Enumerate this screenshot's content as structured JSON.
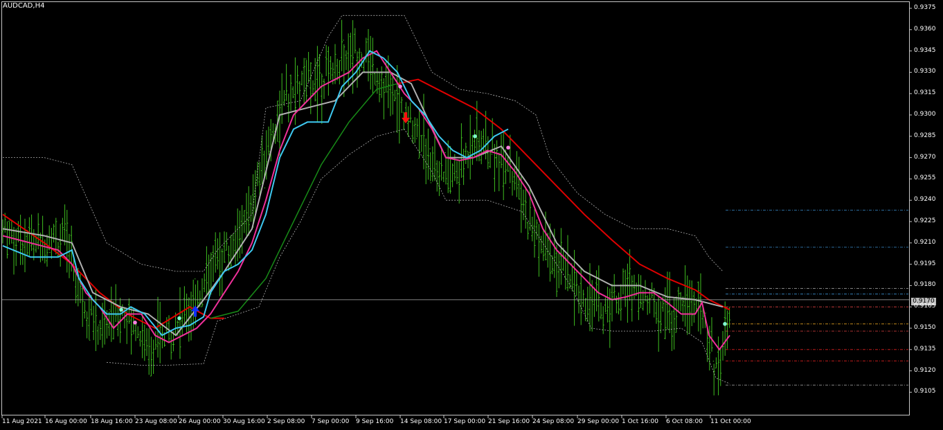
{
  "window": {
    "title": "AUDCAD,H4"
  },
  "price_tag": "0.9170",
  "colors": {
    "background": "#000000",
    "bars": "#3fbf1f",
    "ma_slow": "#e00000",
    "ma_green": "#178a17",
    "line_cyan": "#3ec8f0",
    "line_pink": "#f0309a",
    "line_gray": "#b0b0b0",
    "envelope": "#b0b0b0",
    "up_arrow": "#1030ff",
    "down_arrow": "#ff1010"
  },
  "chart_data": {
    "type": "line",
    "title": "AUDCAD,H4",
    "ylim": [
      0.9095,
      0.9381
    ],
    "y_ticks": [
      "0.9375",
      "0.9360",
      "0.9345",
      "0.9330",
      "0.9315",
      "0.9300",
      "0.9285",
      "0.9270",
      "0.9255",
      "0.9240",
      "0.9225",
      "0.9210",
      "0.9195",
      "0.9180",
      "0.9165",
      "0.9150",
      "0.9135",
      "0.9120",
      "0.9105"
    ],
    "x_ticks": [
      "11 Aug 2021",
      "16 Aug 00:00",
      "18 Aug 16:00",
      "23 Aug 08:00",
      "26 Aug 00:00",
      "30 Aug 16:00",
      "2 Sep 08:00",
      "7 Sep 00:00",
      "9 Sep 16:00",
      "14 Sep 08:00",
      "17 Sep 00:00",
      "21 Sep 16:00",
      "24 Sep 08:00",
      "29 Sep 00:00",
      "1 Oct 16:00",
      "6 Oct 08:00",
      "11 Oct 00:00"
    ],
    "current_price": 0.917,
    "price_series": [
      [
        0,
        0.9218
      ],
      [
        40,
        0.921
      ],
      [
        70,
        0.9214
      ],
      [
        90,
        0.9212
      ],
      [
        100,
        0.92
      ],
      [
        110,
        0.918
      ],
      [
        120,
        0.9165
      ],
      [
        140,
        0.915
      ],
      [
        160,
        0.9158
      ],
      [
        175,
        0.9162
      ],
      [
        195,
        0.915
      ],
      [
        210,
        0.9135
      ],
      [
        230,
        0.914
      ],
      [
        250,
        0.915
      ],
      [
        270,
        0.9165
      ],
      [
        290,
        0.918
      ],
      [
        310,
        0.92
      ],
      [
        330,
        0.9205
      ],
      [
        350,
        0.9225
      ],
      [
        370,
        0.9255
      ],
      [
        390,
        0.929
      ],
      [
        410,
        0.931
      ],
      [
        430,
        0.932
      ],
      [
        450,
        0.9325
      ],
      [
        470,
        0.933
      ],
      [
        490,
        0.934
      ],
      [
        510,
        0.9345
      ],
      [
        530,
        0.9338
      ],
      [
        550,
        0.932
      ],
      [
        570,
        0.931
      ],
      [
        580,
        0.93
      ],
      [
        600,
        0.929
      ],
      [
        620,
        0.927
      ],
      [
        640,
        0.9255
      ],
      [
        660,
        0.926
      ],
      [
        680,
        0.9285
      ],
      [
        700,
        0.9275
      ],
      [
        720,
        0.927
      ],
      [
        740,
        0.926
      ],
      [
        750,
        0.9235
      ],
      [
        770,
        0.9215
      ],
      [
        790,
        0.92
      ],
      [
        810,
        0.919
      ],
      [
        830,
        0.9175
      ],
      [
        850,
        0.917
      ],
      [
        870,
        0.9162
      ],
      [
        890,
        0.9175
      ],
      [
        910,
        0.918
      ],
      [
        930,
        0.917
      ],
      [
        950,
        0.9165
      ],
      [
        970,
        0.916
      ],
      [
        990,
        0.917
      ],
      [
        1010,
        0.9165
      ],
      [
        1020,
        0.914
      ],
      [
        1030,
        0.912
      ],
      [
        1040,
        0.914
      ],
      [
        1050,
        0.917
      ]
    ],
    "series": [
      {
        "name": "",
        "points": [
          [
            0,
            0.923
          ],
          [
            60,
            0.921
          ],
          [
            100,
            0.9195
          ],
          [
            140,
            0.9175
          ],
          [
            180,
            0.916
          ],
          [
            220,
            0.915
          ],
          [
            270,
            0.9165
          ],
          [
            300,
            0.9157
          ],
          [
            320,
            0.9157
          ]
        ]
      },
      {
        "name": "",
        "points": [
          [
            300,
            0.9157
          ],
          [
            340,
            0.9162
          ],
          [
            380,
            0.9185
          ],
          [
            420,
            0.9225
          ],
          [
            460,
            0.9265
          ],
          [
            500,
            0.9295
          ],
          [
            540,
            0.9318
          ],
          [
            570,
            0.9322
          ]
        ]
      },
      {
        "name": "",
        "points": [
          [
            570,
            0.9322
          ],
          [
            600,
            0.9325
          ],
          [
            640,
            0.9315
          ],
          [
            680,
            0.9305
          ],
          [
            720,
            0.929
          ],
          [
            760,
            0.927
          ],
          [
            800,
            0.925
          ],
          [
            840,
            0.923
          ],
          [
            880,
            0.9212
          ],
          [
            920,
            0.9195
          ],
          [
            960,
            0.9185
          ],
          [
            1000,
            0.9177
          ],
          [
            1020,
            0.917
          ],
          [
            1050,
            0.9163
          ]
        ]
      },
      {
        "name": "",
        "points": [
          [
            0,
            0.9208
          ],
          [
            40,
            0.92
          ],
          [
            60,
            0.92
          ],
          [
            80,
            0.92
          ],
          [
            100,
            0.9205
          ],
          [
            110,
            0.9185
          ],
          [
            130,
            0.917
          ],
          [
            150,
            0.916
          ],
          [
            170,
            0.916
          ],
          [
            185,
            0.9165
          ],
          [
            205,
            0.916
          ],
          [
            230,
            0.9145
          ],
          [
            250,
            0.915
          ],
          [
            270,
            0.9152
          ],
          [
            290,
            0.9158
          ],
          [
            300,
            0.9175
          ],
          [
            320,
            0.919
          ],
          [
            340,
            0.9195
          ],
          [
            360,
            0.9205
          ],
          [
            380,
            0.923
          ],
          [
            400,
            0.927
          ],
          [
            420,
            0.929
          ],
          [
            440,
            0.9295
          ],
          [
            470,
            0.9295
          ],
          [
            490,
            0.932
          ],
          [
            510,
            0.933
          ],
          [
            530,
            0.9345
          ],
          [
            550,
            0.934
          ],
          [
            570,
            0.933
          ],
          [
            590,
            0.931
          ],
          [
            610,
            0.93
          ],
          [
            630,
            0.9285
          ],
          [
            650,
            0.9275
          ],
          [
            670,
            0.927
          ],
          [
            690,
            0.9275
          ],
          [
            710,
            0.9285
          ],
          [
            730,
            0.929
          ]
        ]
      },
      {
        "name": "",
        "points": [
          [
            0,
            0.9215
          ],
          [
            40,
            0.921
          ],
          [
            80,
            0.9205
          ],
          [
            100,
            0.9195
          ],
          [
            120,
            0.9175
          ],
          [
            140,
            0.9165
          ],
          [
            160,
            0.915
          ],
          [
            180,
            0.916
          ],
          [
            200,
            0.916
          ],
          [
            220,
            0.9145
          ],
          [
            240,
            0.914
          ],
          [
            260,
            0.9145
          ],
          [
            280,
            0.915
          ],
          [
            300,
            0.916
          ],
          [
            320,
            0.9175
          ],
          [
            340,
            0.919
          ],
          [
            360,
            0.921
          ],
          [
            380,
            0.924
          ],
          [
            400,
            0.9275
          ],
          [
            420,
            0.93
          ],
          [
            440,
            0.931
          ],
          [
            460,
            0.932
          ],
          [
            480,
            0.9325
          ],
          [
            500,
            0.933
          ],
          [
            520,
            0.934
          ],
          [
            540,
            0.9345
          ],
          [
            560,
            0.933
          ],
          [
            580,
            0.9315
          ],
          [
            600,
            0.9305
          ],
          [
            620,
            0.929
          ],
          [
            640,
            0.927
          ],
          [
            660,
            0.9268
          ],
          [
            680,
            0.927
          ],
          [
            700,
            0.9275
          ],
          [
            720,
            0.9272
          ],
          [
            740,
            0.926
          ],
          [
            760,
            0.9245
          ],
          [
            780,
            0.922
          ],
          [
            800,
            0.9205
          ],
          [
            820,
            0.9195
          ],
          [
            840,
            0.9185
          ],
          [
            860,
            0.9175
          ],
          [
            880,
            0.917
          ],
          [
            900,
            0.9172
          ],
          [
            920,
            0.9175
          ],
          [
            940,
            0.9175
          ],
          [
            960,
            0.9168
          ],
          [
            980,
            0.916
          ],
          [
            1000,
            0.916
          ],
          [
            1010,
            0.9168
          ],
          [
            1020,
            0.9145
          ],
          [
            1035,
            0.9135
          ],
          [
            1050,
            0.9145
          ]
        ]
      },
      {
        "name": "",
        "points": [
          [
            0,
            0.922
          ],
          [
            60,
            0.9215
          ],
          [
            100,
            0.921
          ],
          [
            130,
            0.9175
          ],
          [
            170,
            0.9165
          ],
          [
            210,
            0.916
          ],
          [
            250,
            0.9145
          ],
          [
            290,
            0.917
          ],
          [
            320,
            0.919
          ],
          [
            360,
            0.922
          ],
          [
            400,
            0.93
          ],
          [
            440,
            0.9305
          ],
          [
            480,
            0.931
          ],
          [
            520,
            0.933
          ],
          [
            560,
            0.933
          ],
          [
            590,
            0.9322
          ],
          [
            640,
            0.927
          ],
          [
            680,
            0.927
          ],
          [
            720,
            0.9278
          ],
          [
            760,
            0.925
          ],
          [
            800,
            0.921
          ],
          [
            840,
            0.919
          ],
          [
            880,
            0.918
          ],
          [
            920,
            0.918
          ],
          [
            960,
            0.9172
          ],
          [
            1000,
            0.917
          ],
          [
            1040,
            0.9165
          ]
        ]
      }
    ],
    "envelope_upper": [
      [
        0,
        0.927
      ],
      [
        60,
        0.927
      ],
      [
        100,
        0.9265
      ],
      [
        150,
        0.921
      ],
      [
        200,
        0.9195
      ],
      [
        250,
        0.919
      ],
      [
        290,
        0.919
      ],
      [
        310,
        0.9205
      ],
      [
        360,
        0.923
      ],
      [
        380,
        0.9305
      ],
      [
        430,
        0.931
      ],
      [
        470,
        0.9355
      ],
      [
        490,
        0.937
      ],
      [
        580,
        0.937
      ],
      [
        600,
        0.935
      ],
      [
        620,
        0.933
      ],
      [
        660,
        0.9318
      ],
      [
        700,
        0.9315
      ],
      [
        740,
        0.931
      ],
      [
        770,
        0.93
      ],
      [
        790,
        0.927
      ],
      [
        830,
        0.9245
      ],
      [
        870,
        0.923
      ],
      [
        910,
        0.922
      ],
      [
        960,
        0.922
      ],
      [
        1000,
        0.9215
      ],
      [
        1020,
        0.92
      ],
      [
        1040,
        0.919
      ]
    ],
    "envelope_lower": [
      [
        150,
        0.9126
      ],
      [
        200,
        0.9124
      ],
      [
        240,
        0.9124
      ],
      [
        290,
        0.9125
      ],
      [
        310,
        0.9155
      ],
      [
        340,
        0.916
      ],
      [
        370,
        0.9165
      ],
      [
        400,
        0.92
      ],
      [
        430,
        0.9225
      ],
      [
        460,
        0.9255
      ],
      [
        500,
        0.9272
      ],
      [
        540,
        0.9285
      ],
      [
        580,
        0.929
      ],
      [
        620,
        0.926
      ],
      [
        640,
        0.924
      ],
      [
        700,
        0.924
      ],
      [
        750,
        0.9232
      ],
      [
        780,
        0.921
      ],
      [
        820,
        0.918
      ],
      [
        850,
        0.915
      ],
      [
        880,
        0.9148
      ],
      [
        940,
        0.9148
      ],
      [
        980,
        0.915
      ],
      [
        1010,
        0.914
      ],
      [
        1030,
        0.9115
      ],
      [
        1050,
        0.9111
      ]
    ],
    "right_levels": [
      {
        "price": 0.9233,
        "color": "#3a8fd0"
      },
      {
        "price": 0.9207,
        "color": "#3a8fd0"
      },
      {
        "price": 0.9178,
        "color": "#b0b0b0"
      },
      {
        "price": 0.9174,
        "color": "#3a8fd0"
      },
      {
        "price": 0.9165,
        "color": "#e04040"
      },
      {
        "price": 0.9153,
        "color": "#e0a020"
      },
      {
        "price": 0.9148,
        "color": "#e04040"
      },
      {
        "price": 0.9135,
        "color": "#e02020"
      },
      {
        "price": 0.9127,
        "color": "#e02020"
      },
      {
        "price": 0.911,
        "color": "#b0b0b0"
      }
    ],
    "markers": [
      {
        "x": 171,
        "price": 0.9163,
        "color": "#80ffd0"
      },
      {
        "x": 191,
        "price": 0.9154,
        "color": "#ff80e0"
      },
      {
        "x": 255,
        "price": 0.9157,
        "color": "#80ffd0"
      },
      {
        "x": 574,
        "price": 0.932,
        "color": "#ff80e0"
      },
      {
        "x": 682,
        "price": 0.9285,
        "color": "#80ffd0"
      },
      {
        "x": 730,
        "price": 0.9277,
        "color": "#ff80e0"
      },
      {
        "x": 1043,
        "price": 0.9153,
        "color": "#80ffd0"
      }
    ],
    "arrows": [
      {
        "x": 278,
        "price": 0.9162,
        "dir": "up"
      },
      {
        "x": 582,
        "price": 0.9298,
        "dir": "down"
      }
    ]
  }
}
